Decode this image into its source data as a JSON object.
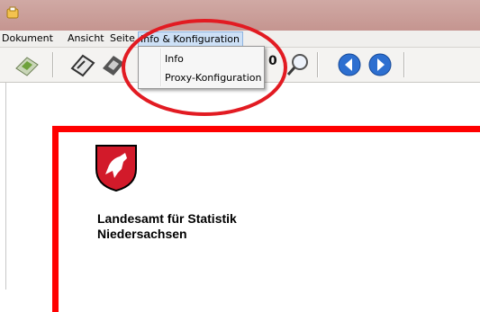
{
  "menubar": {
    "items": [
      "Dokument",
      "Ansicht",
      "Seite",
      "Info & Konfiguration"
    ]
  },
  "dropdown": {
    "items": [
      "Info",
      "Proxy-Konfiguration"
    ]
  },
  "document": {
    "org_line1": "Landesamt für Statistik",
    "org_line2": "Niedersachsen"
  },
  "colors": {
    "frame": "#ff0000",
    "annotation": "#e21b22",
    "menu_highlight": "#cde0f6"
  },
  "icons": [
    "app-icon",
    "send-icon",
    "edit-icon",
    "save-icon",
    "print-icon",
    "zoom-icon",
    "back-icon",
    "forward-icon",
    "crest-icon"
  ]
}
